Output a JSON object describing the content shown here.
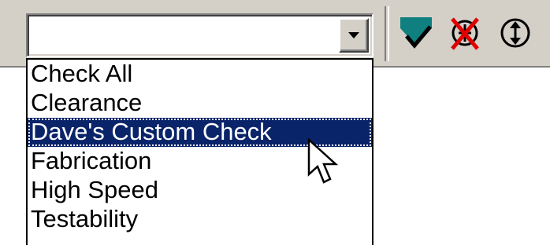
{
  "combo": {
    "value": "",
    "icon": "dropdown-arrow-icon"
  },
  "toolbar": {
    "icons": [
      "checkmark-icon",
      "disabled-check-icon",
      "expand-vertical-icon"
    ]
  },
  "dropdown": {
    "items": [
      {
        "label": "Check All"
      },
      {
        "label": "Clearance"
      },
      {
        "label": "Dave's Custom Check",
        "selected": true
      },
      {
        "label": "Fabrication"
      },
      {
        "label": "High Speed"
      },
      {
        "label": "Testability"
      }
    ]
  },
  "colors": {
    "toolbar_bg": "#d4d0c8",
    "selection": "#0a246a",
    "check_teal": "#0f7f7f",
    "red_x": "#e00000"
  }
}
